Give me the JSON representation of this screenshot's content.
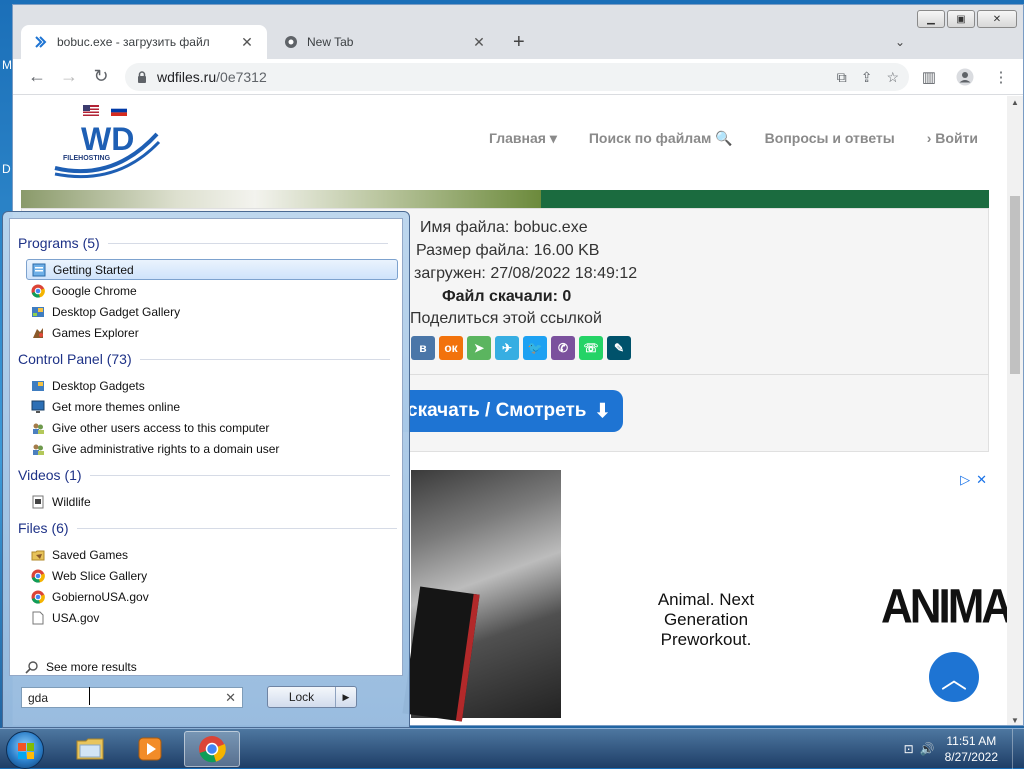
{
  "desktop": {
    "fragments": [
      "M",
      "D",
      "D"
    ]
  },
  "browser": {
    "tabs": [
      {
        "title": "bobuc.exe - загрузить файл",
        "active": true
      },
      {
        "title": "New Tab",
        "active": false
      }
    ],
    "url_host": "wdfiles.ru",
    "url_path": "/0e7312"
  },
  "site": {
    "logo_text": "WD",
    "logo_sub": "FILEHOSTING",
    "nav": [
      "Главная ▾",
      "Поиск по файлам 🔍",
      "Вопросы и ответы",
      "› Войти"
    ]
  },
  "file": {
    "name_label": "Имя файла:",
    "name_value": "bobuc.exe",
    "size_label": "Размер файла:",
    "size_value": "16.00 KB",
    "uploaded_label": "загружен:",
    "uploaded_value": "27/08/2022 18:49:12",
    "downloads_label": "Файл скачали:",
    "downloads_value": "0",
    "share_label": "Поделиться этой ссылкой",
    "download_button": "скачать / Смотреть"
  },
  "share_colors": {
    "vk": "#4a76a8",
    "ok": "#f2720c",
    "vb": "#5bb55f",
    "tg": "#37aee2",
    "tw": "#1da1f2",
    "viber": "#7b519d",
    "wa": "#25d366",
    "lj": "#00526b"
  },
  "ad": {
    "tagline_1": "Animal. Next Generation",
    "tagline_2": "Preworkout.",
    "brand": "ANIMAL"
  },
  "start_menu": {
    "sections": [
      {
        "title": "Programs (5)",
        "items": [
          "Getting Started",
          "Google Chrome",
          "Desktop Gadget Gallery",
          "Games Explorer"
        ]
      },
      {
        "title": "Control Panel (73)",
        "items": [
          "Desktop Gadgets",
          "Get more themes online",
          "Give other users access to this computer",
          "Give administrative rights to a domain user"
        ]
      },
      {
        "title": "Videos (1)",
        "items": [
          "Wildlife"
        ]
      },
      {
        "title": "Files (6)",
        "items": [
          "Saved Games",
          "Web Slice Gallery",
          "GobiernoUSA.gov",
          "USA.gov"
        ]
      }
    ],
    "see_more": "See more results",
    "search_value": "gda",
    "lock_label": "Lock"
  },
  "taskbar": {
    "time": "11:51 AM",
    "date": "8/27/2022"
  }
}
